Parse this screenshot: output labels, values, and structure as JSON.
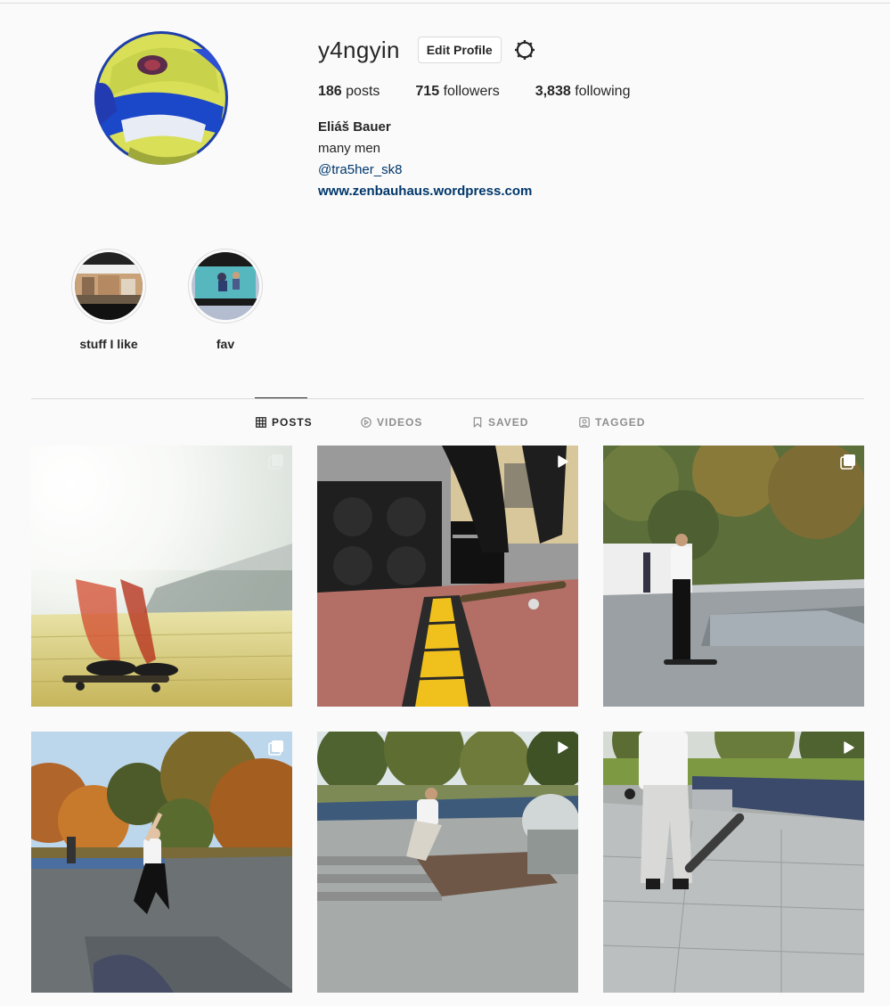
{
  "profile": {
    "username": "y4ngyin",
    "edit_label": "Edit Profile",
    "posts_count": "186",
    "posts_label": "posts",
    "followers_count": "715",
    "followers_label": "followers",
    "following_count": "3,838",
    "following_label": "following",
    "full_name": "Eliáš Bauer",
    "bio": "many men",
    "mention": "@tra5her_sk8",
    "website": "www.zenbauhaus.wordpress.com"
  },
  "highlights": [
    {
      "label": "stuff I like"
    },
    {
      "label": "fav"
    }
  ],
  "tabs": [
    {
      "label": "POSTS",
      "icon": "grid-icon",
      "active": true
    },
    {
      "label": "VIDEOS",
      "icon": "play-circle-icon",
      "active": false
    },
    {
      "label": "SAVED",
      "icon": "bookmark-icon",
      "active": false
    },
    {
      "label": "TAGGED",
      "icon": "tag-user-icon",
      "active": false
    }
  ],
  "posts": [
    {
      "type": "carousel"
    },
    {
      "type": "video"
    },
    {
      "type": "carousel"
    },
    {
      "type": "carousel"
    },
    {
      "type": "video"
    },
    {
      "type": "video"
    }
  ],
  "colors": {
    "text": "#262626",
    "muted": "#8e8e8e",
    "link": "#00376b",
    "border": "#dbdbdb",
    "background": "#fafafa"
  }
}
